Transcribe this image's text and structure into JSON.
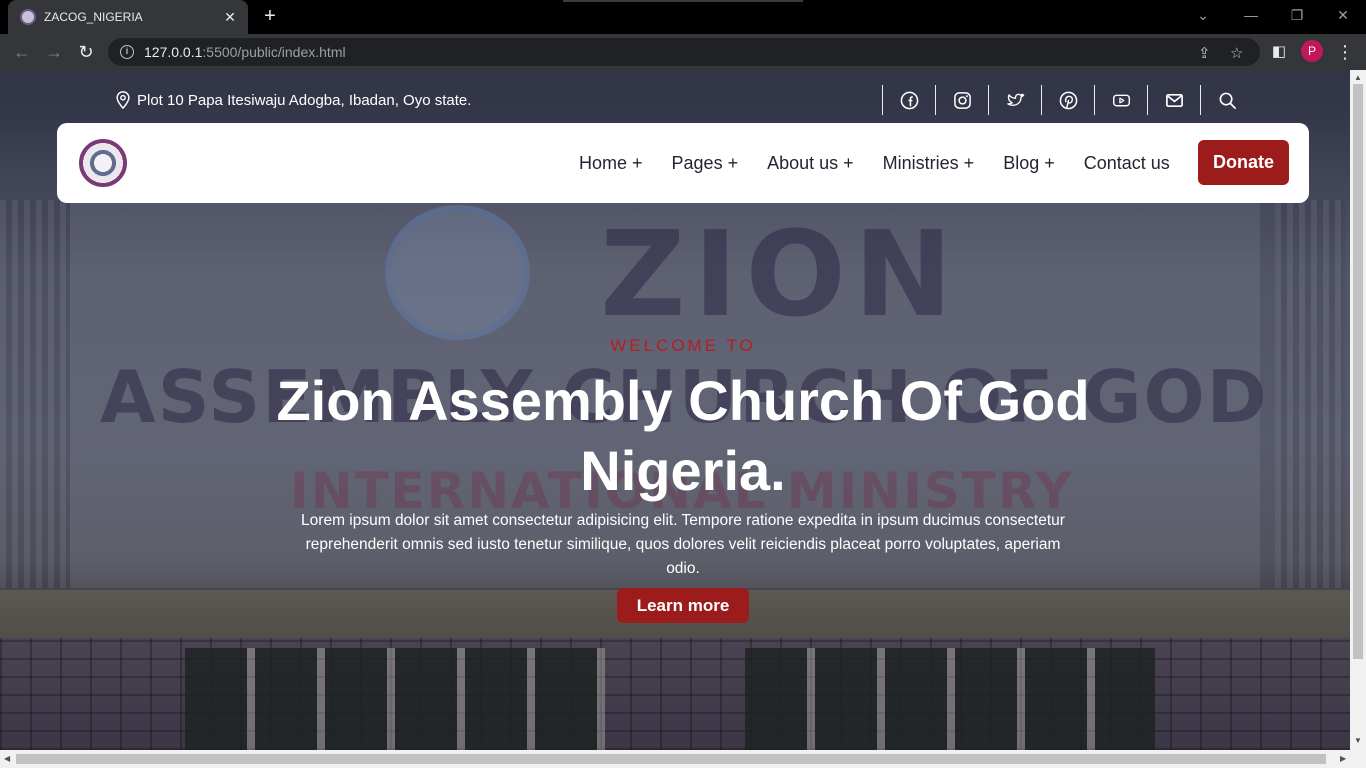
{
  "browser": {
    "tab_title": "ZACOG_NIGERIA",
    "tab_close": "✕",
    "new_tab": "+",
    "url_host": "127.0.0.1",
    "url_path": ":5500/public/index.html",
    "profile_initial": "P"
  },
  "topbar": {
    "address": "Plot 10 Papa Itesiwaju Adogba, Ibadan, Oyo state.",
    "socials": [
      "facebook-icon",
      "instagram-icon",
      "twitter-icon",
      "pinterest-icon",
      "youtube-icon",
      "mail-icon",
      "search-icon"
    ]
  },
  "nav": {
    "items": [
      {
        "label": "Home +"
      },
      {
        "label": "Pages +"
      },
      {
        "label": "About us +"
      },
      {
        "label": "Ministries +"
      },
      {
        "label": "Blog +"
      },
      {
        "label": "Contact us"
      }
    ],
    "donate_label": "Donate"
  },
  "hero": {
    "eyebrow": "WELCOME TO",
    "title": "Zion Assembly Church Of God Nigeria.",
    "description": "Lorem ipsum dolor sit amet consectetur adipisicing elit. Tempore ratione expedita in ipsum ducimus consectetur reprehenderit omnis sed iusto tenetur similique, quos dolores velit reiciendis placeat porro voluptates, aperiam odio.",
    "cta_label": "Learn more"
  },
  "colors": {
    "accent": "#9c1c1c",
    "eyebrow": "#b51f1f",
    "nav_text": "#1f2430"
  }
}
